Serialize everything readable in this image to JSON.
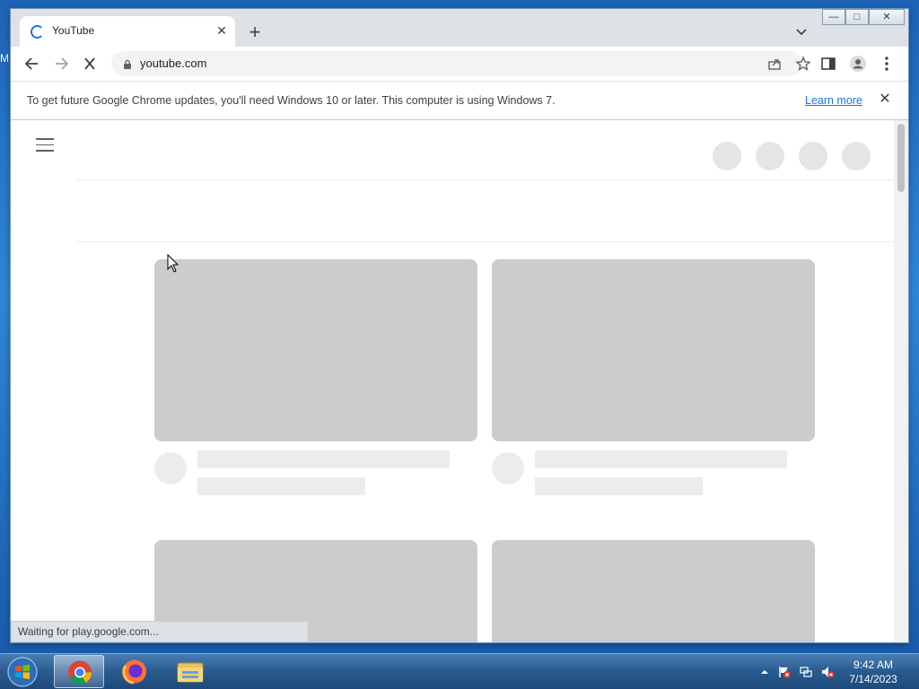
{
  "desktop": {
    "edge_text": "M"
  },
  "browser": {
    "tab": {
      "title": "YouTube"
    },
    "address": {
      "url": "youtube.com"
    },
    "infobar": {
      "message": "To get future Google Chrome updates, you'll need Windows 10 or later. This computer is using Windows 7.",
      "link": "Learn more"
    },
    "status": "Waiting for play.google.com..."
  },
  "taskbar": {
    "time": "9:42 AM",
    "date": "7/14/2023"
  },
  "icons": {
    "tab_loading": "spinner-icon",
    "back": "arrow-left-icon",
    "forward": "arrow-right-icon",
    "stop": "close-icon",
    "lock": "lock-icon",
    "share": "share-icon",
    "bookmark": "star-icon",
    "side_panel": "side-panel-icon",
    "profile": "profile-icon",
    "menu": "kebab-menu-icon"
  },
  "colors": {
    "accent": "#1a73e8",
    "skeleton": "#cccccc",
    "skeleton_light": "#ececec"
  }
}
